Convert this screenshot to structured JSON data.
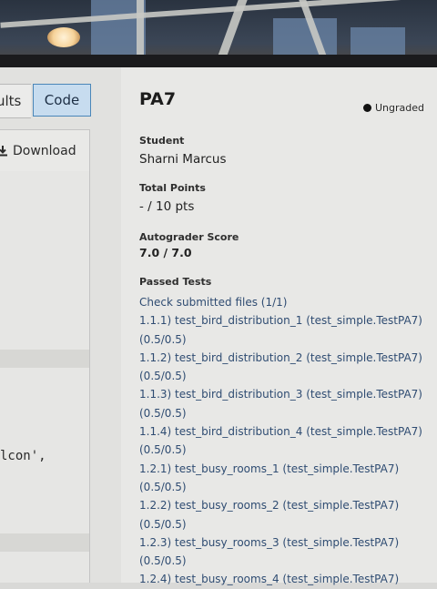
{
  "left_panel": {
    "tab_results_label": "ults",
    "tab_code_label": "Code",
    "download_label": "Download",
    "download_icon": "download-icon",
    "code_visible_text": "lcon',"
  },
  "header": {
    "title": "PA7",
    "status": "Ungraded"
  },
  "student": {
    "label": "Student",
    "name": "Sharni Marcus"
  },
  "total_points": {
    "label": "Total Points",
    "value": "- / 10 pts"
  },
  "autograder": {
    "label": "Autograder Score",
    "value": "7.0 / 7.0"
  },
  "passed_tests": {
    "label": "Passed Tests",
    "lines": [
      "Check submitted files (1/1)",
      "1.1.1) test_bird_distribution_1 (test_simple.TestPA7)",
      "(0.5/0.5)",
      "1.1.2) test_bird_distribution_2 (test_simple.TestPA7)",
      "(0.5/0.5)",
      "1.1.3) test_bird_distribution_3 (test_simple.TestPA7)",
      "(0.5/0.5)",
      "1.1.4) test_bird_distribution_4 (test_simple.TestPA7)",
      "(0.5/0.5)",
      "1.2.1) test_busy_rooms_1 (test_simple.TestPA7)",
      "(0.5/0.5)",
      "1.2.2) test_busy_rooms_2 (test_simple.TestPA7)",
      "(0.5/0.5)",
      "1.2.3) test_busy_rooms_3 (test_simple.TestPA7)",
      "(0.5/0.5)",
      "1.2.4) test_busy_rooms_4 (test_simple.TestPA7)"
    ]
  }
}
